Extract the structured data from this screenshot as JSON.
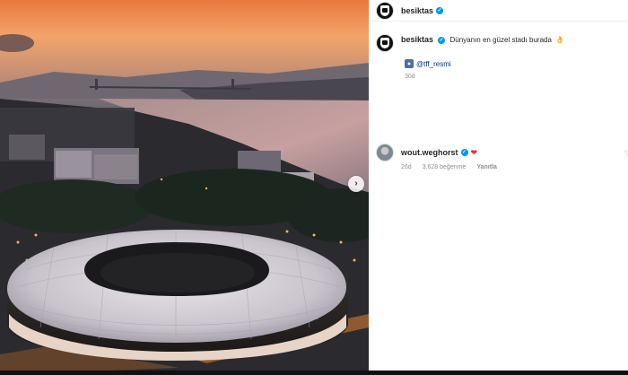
{
  "post": {
    "author": "besiktas",
    "author_verified": true,
    "caption": "Dünyanın en güzel stadı burada",
    "caption_emoji": "👌",
    "mention_icon": "person-tag-icon",
    "mention": "@tff_resmi",
    "time": "30d"
  },
  "comments": [
    {
      "author": "wout.weghorst",
      "verified": true,
      "emoji": "❤",
      "time": "26d",
      "likes": "3.628 beğenme",
      "reply_label": "Yanıtla"
    }
  ],
  "icons": {
    "carousel_next": "chevron-right-icon",
    "verified": "verified-badge-icon",
    "heart": "heart-icon"
  },
  "colors": {
    "verified_blue": "#0095f6",
    "mention_blue": "#00376b",
    "heart_red": "#ed2d3b",
    "muted_gray": "#8e8e8e"
  }
}
